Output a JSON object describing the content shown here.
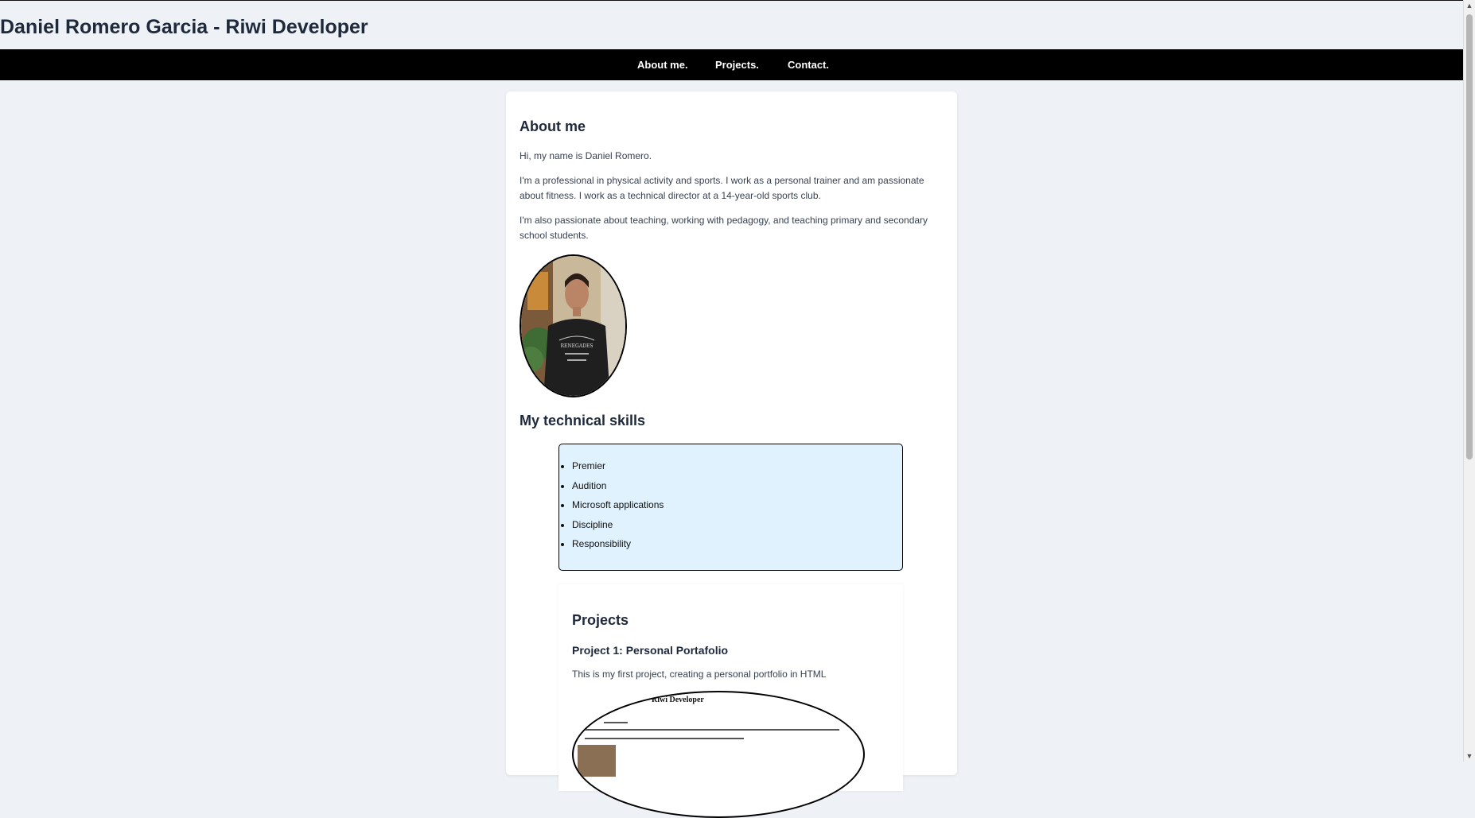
{
  "header": {
    "title": "Daniel Romero Garcia - Riwi Developer"
  },
  "nav": {
    "items": [
      {
        "label": "About me."
      },
      {
        "label": "Projects."
      },
      {
        "label": "Contact."
      }
    ]
  },
  "about": {
    "title": "About me",
    "paragraphs": [
      "Hi, my name is Daniel Romero.",
      "I'm a professional in physical activity and sports. I work as a personal trainer and am passionate about fitness. I work as a technical director at a 14-year-old sports club.",
      "I'm also passionate about teaching, working with pedagogy, and teaching primary and secondary school students."
    ]
  },
  "skills": {
    "title": "My technical skills",
    "items": [
      "Premier",
      "Audition",
      "Microsoft applications",
      "Discipline",
      "Responsibility"
    ]
  },
  "projects": {
    "title": "Projects",
    "project1": {
      "title": "Project 1: Personal Portafolio",
      "description": "This is my first project, creating a personal portfolio in HTML",
      "thumbnail_title": "Riwi Developer"
    }
  },
  "colors": {
    "page_bg": "#eef2f7",
    "navbar_bg": "#000000",
    "skills_bg": "#e0f2fe",
    "title_text": "#1e293b"
  }
}
